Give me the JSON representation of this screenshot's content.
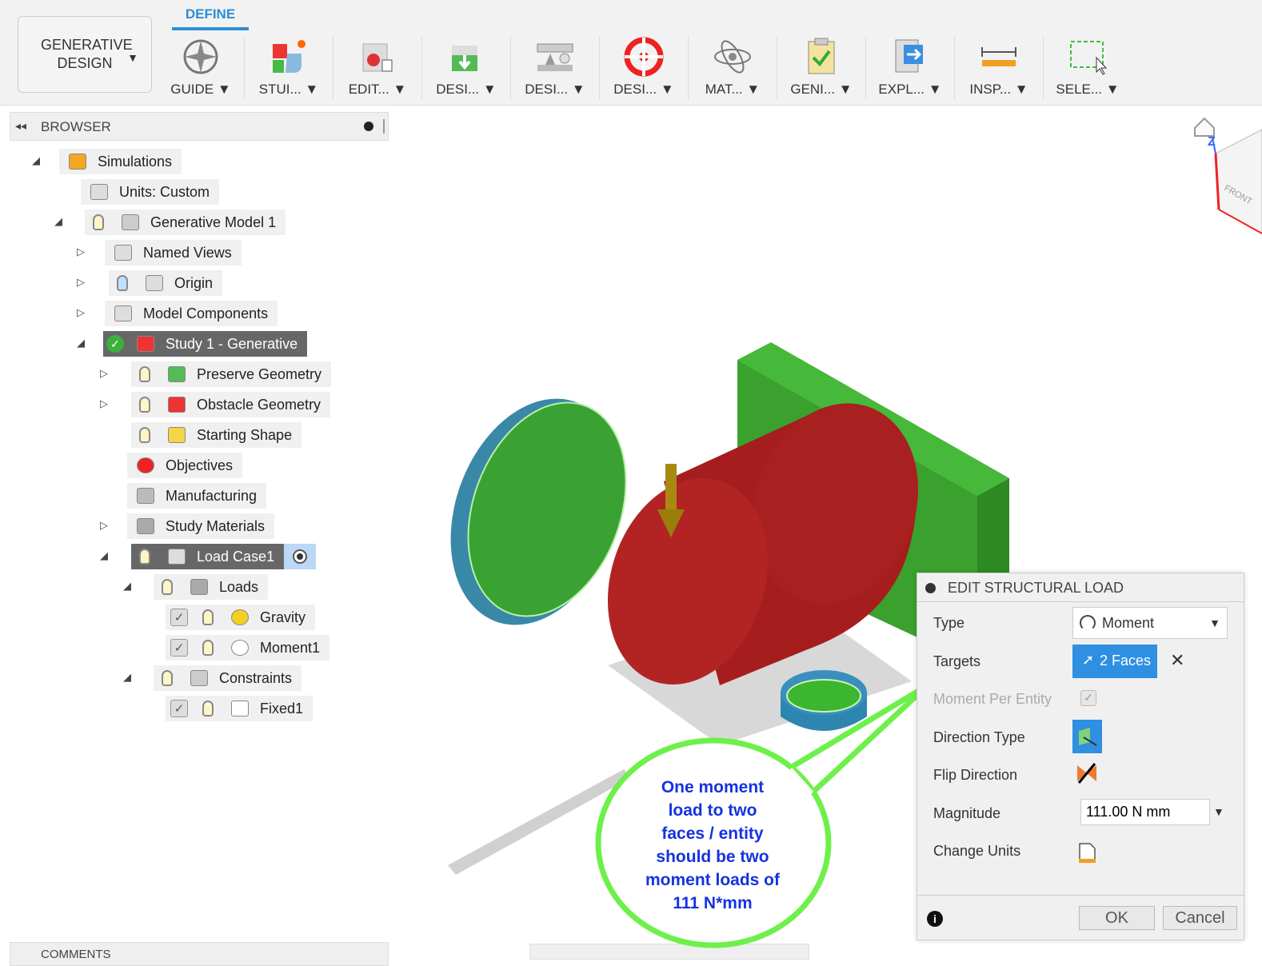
{
  "toolbar": {
    "workspace": "GENERATIVE DESIGN",
    "active_tab": "DEFINE",
    "tools": [
      "GUIDE",
      "STUI...",
      "EDIT...",
      "DESI...",
      "DESI...",
      "DESI...",
      "MAT...",
      "GENI...",
      "EXPL...",
      "INSP...",
      "SELE..."
    ]
  },
  "browser": {
    "title": "BROWSER",
    "items": [
      "Simulations",
      "Units: Custom",
      "Generative Model 1",
      "Named Views",
      "Origin",
      "Model Components",
      "Study 1 - Generative",
      "Preserve Geometry",
      "Obstacle Geometry",
      "Starting Shape",
      "Objectives",
      "Manufacturing",
      "Study Materials",
      "Load Case1",
      "Loads",
      "Gravity",
      "Moment1",
      "Constraints",
      "Fixed1"
    ]
  },
  "comments": {
    "title": "COMMENTS"
  },
  "viewcube": {
    "face": "FRONT",
    "axis": "Z"
  },
  "dialog": {
    "title": "EDIT STRUCTURAL LOAD",
    "type_label": "Type",
    "type_value": "Moment",
    "targets_label": "Targets",
    "targets_value": "2 Faces",
    "per_entity_label": "Moment Per Entity",
    "per_entity_checked": true,
    "direction_type_label": "Direction Type",
    "flip_label": "Flip Direction",
    "magnitude_label": "Magnitude",
    "magnitude_value": "111.00 N mm",
    "change_units_label": "Change Units",
    "ok": "OK",
    "cancel": "Cancel"
  },
  "callout": {
    "lines": [
      "One moment",
      "load to two",
      "faces / entity",
      "should be two",
      "moment loads of",
      "111 N*mm"
    ]
  },
  "colors": {
    "accent": "#2a8fd6",
    "callout": "#6ef04a",
    "callout_text": "#1532e0"
  }
}
